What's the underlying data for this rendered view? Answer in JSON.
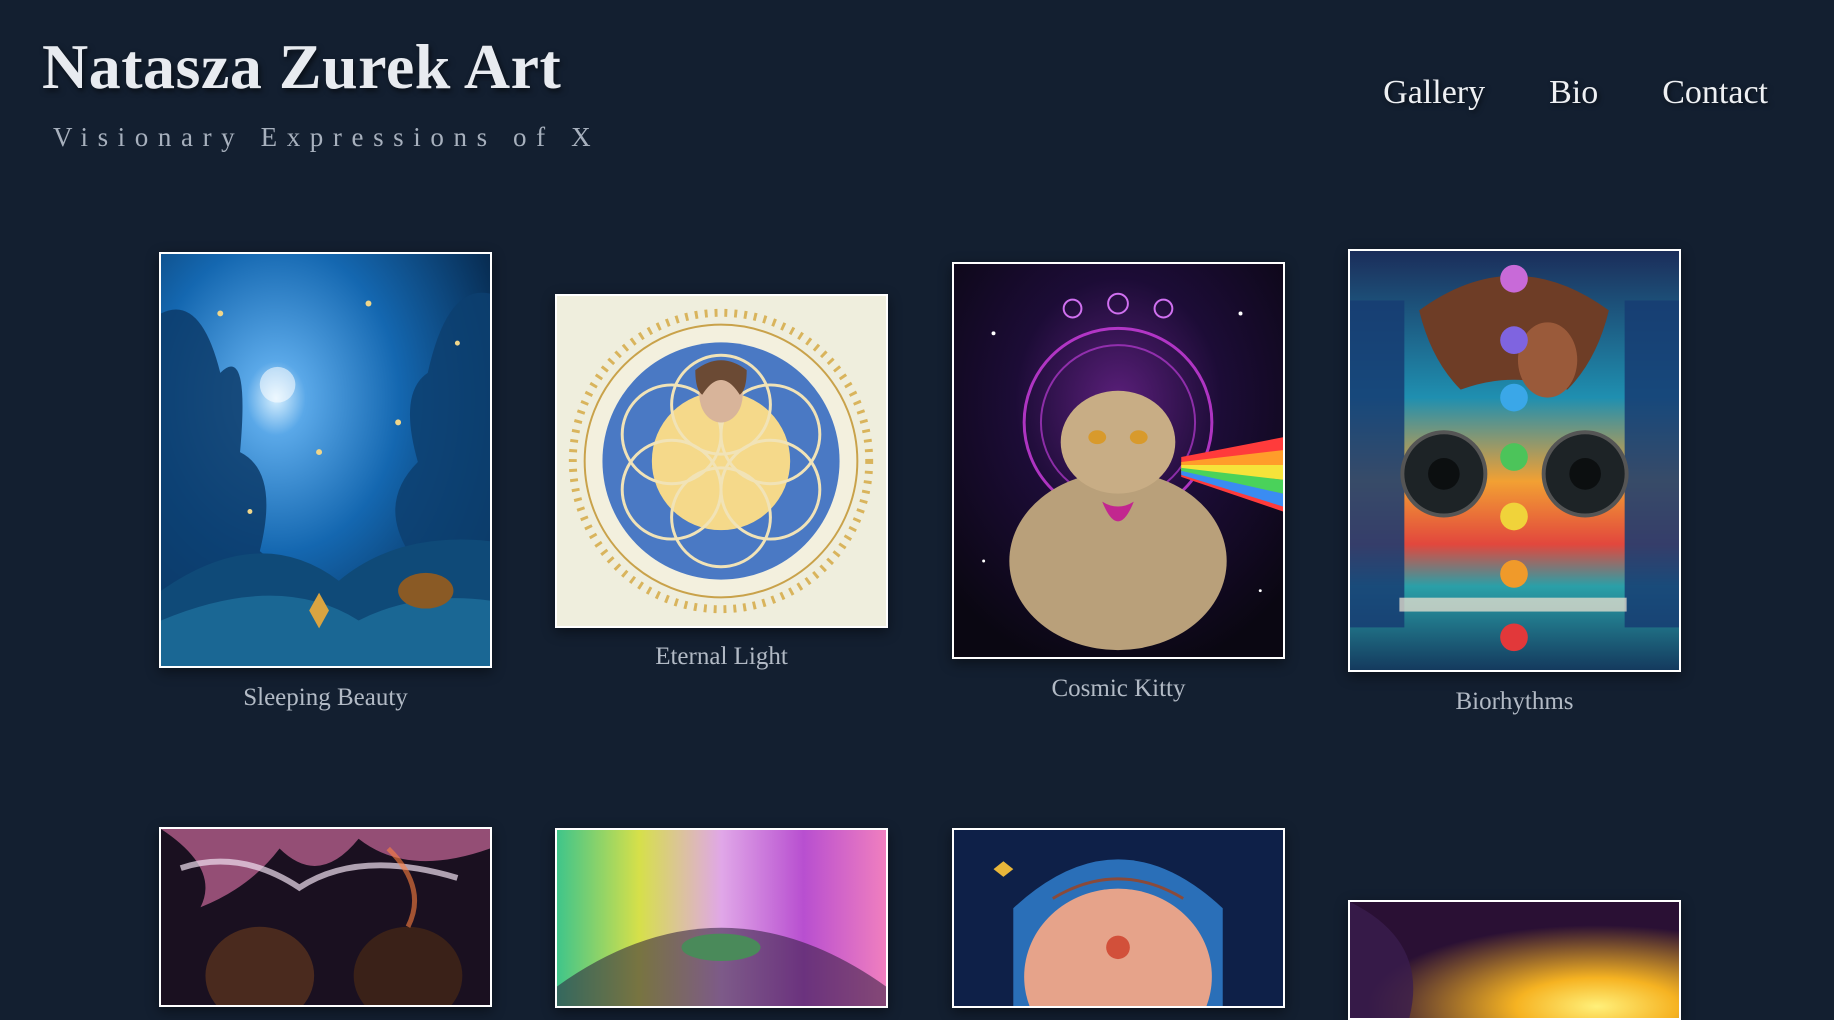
{
  "site": {
    "title": "Natasza Zurek Art",
    "tagline": "Visionary Expressions of X"
  },
  "nav": {
    "items": [
      "Gallery",
      "Bio",
      "Contact"
    ]
  },
  "gallery": {
    "items": [
      {
        "title": "Sleeping Beauty"
      },
      {
        "title": "Eternal Light"
      },
      {
        "title": "Cosmic Kitty"
      },
      {
        "title": "Biorhythms"
      },
      {
        "title": ""
      },
      {
        "title": ""
      },
      {
        "title": ""
      },
      {
        "title": ""
      }
    ]
  },
  "colors": {
    "background": "#131f30",
    "frame": "#ffffff",
    "caption": "#b2bac5"
  }
}
